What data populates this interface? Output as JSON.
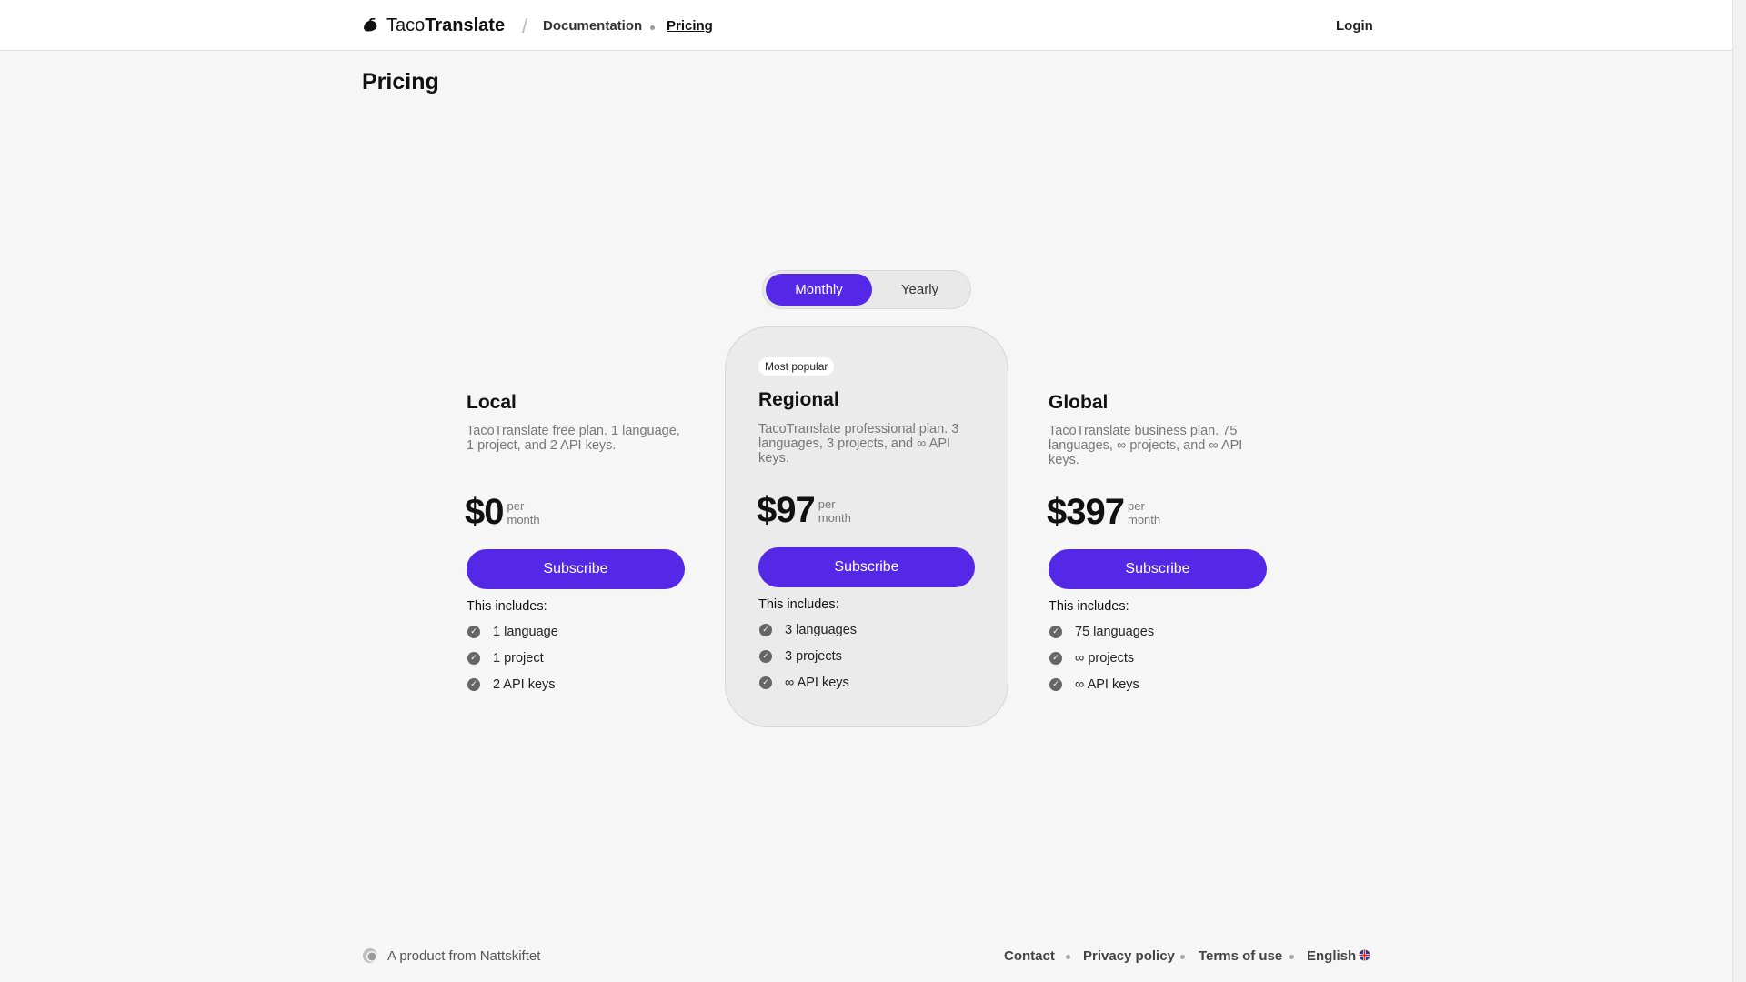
{
  "header": {
    "brand_light": "Taco",
    "brand_bold": "Translate",
    "nav_documentation": "Documentation",
    "nav_pricing": "Pricing",
    "login": "Login"
  },
  "page_title": "Pricing",
  "billing_toggle": {
    "monthly": "Monthly",
    "yearly": "Yearly",
    "selected": "Monthly"
  },
  "plans": [
    {
      "name": "Local",
      "description": "TacoTranslate free plan. 1 language, 1 project, and 2 API keys.",
      "price": "$0",
      "per": "per",
      "period": "month",
      "cta": "Subscribe",
      "includes_label": "This includes:",
      "features": [
        "1 language",
        "1 project",
        "2 API keys"
      ]
    },
    {
      "badge": "Most popular",
      "name": "Regional",
      "description": "TacoTranslate professional plan. 3 languages, 3 projects, and ∞ API keys.",
      "price": "$97",
      "per": "per",
      "period": "month",
      "cta": "Subscribe",
      "includes_label": "This includes:",
      "features": [
        "3 languages",
        "3 projects",
        "∞ API keys"
      ]
    },
    {
      "name": "Global",
      "description": "TacoTranslate business plan. 75 languages, ∞ projects, and ∞ API keys.",
      "price": "$397",
      "per": "per",
      "period": "month",
      "cta": "Subscribe",
      "includes_label": "This includes:",
      "features": [
        "75 languages",
        "∞ projects",
        "∞ API keys"
      ]
    }
  ],
  "footer": {
    "product_from": "A product from Nattskiftet",
    "contact": "Contact",
    "privacy": "Privacy policy",
    "terms": "Terms of use",
    "language": "English"
  },
  "colors": {
    "accent": "#5428e6",
    "background": "#f6f6f6"
  },
  "icons": {
    "logo": "taco-logo-icon",
    "check": "check-circle-icon",
    "footer_logo": "nattskiftet-logo-icon",
    "flag": "uk-flag-icon"
  }
}
